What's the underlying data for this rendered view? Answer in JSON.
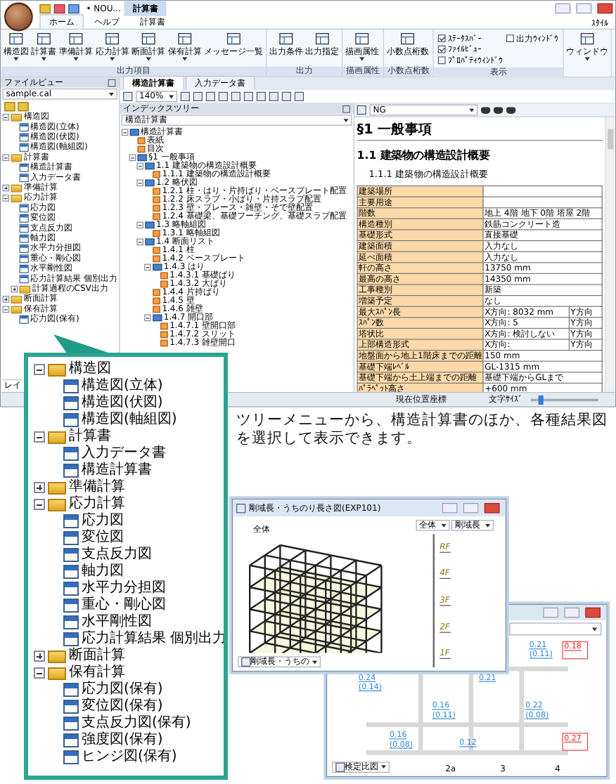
{
  "app": {
    "title": "• NOU...",
    "title_tab": "計算書",
    "style_menu": "ｽﾀｲﾙ",
    "ribbon_tabs": [
      {
        "label": "ホーム",
        "selected": true
      },
      {
        "label": "ヘルプ",
        "selected": false
      },
      {
        "label": "計算書",
        "selected": false
      }
    ],
    "groups": [
      {
        "kind": "buttons",
        "label": "出力項目",
        "buttons": [
          {
            "label": "構造図",
            "dropdown": true
          },
          {
            "label": "計算書",
            "dropdown": true
          },
          {
            "label": "準備計算",
            "dropdown": true
          },
          {
            "label": "応力計算",
            "dropdown": true
          },
          {
            "label": "断面計算",
            "dropdown": true
          },
          {
            "label": "保有計算",
            "dropdown": true
          },
          {
            "label": "メッセージ一覧",
            "dropdown": false
          }
        ]
      },
      {
        "kind": "buttons",
        "label": "出力",
        "buttons": [
          {
            "label": "出力条件",
            "dropdown": false
          },
          {
            "label": "出力指定",
            "dropdown": false
          }
        ]
      },
      {
        "kind": "buttons",
        "label": "描画属性",
        "buttons": [
          {
            "label": "描画属性",
            "dropdown": true
          }
        ]
      },
      {
        "kind": "buttons",
        "label": "小数点桁数",
        "buttons": [
          {
            "label": "小数点桁数",
            "dropdown": false
          }
        ]
      },
      {
        "kind": "checks",
        "label": "表示",
        "checks": [
          {
            "label": "ｽﾃｰﾀｽﾊﾞｰ",
            "checked": true
          },
          {
            "label": "ﾌｧｲﾙﾋﾞｭｰ",
            "checked": true
          },
          {
            "label": "ﾌﾟﾛﾊﾟﾃｨｳｨﾝﾄﾞｳ",
            "checked": false
          },
          {
            "label": "出力ｳｨﾝﾄﾞｳ",
            "checked": false
          }
        ]
      },
      {
        "kind": "buttons",
        "buttons": [
          {
            "label": "ウィンドウ",
            "dropdown": true
          }
        ]
      }
    ]
  },
  "file_view": {
    "title": "ファイルビュー",
    "file": "sample.cal",
    "bottom_tab": "レイ",
    "tree": [
      {
        "label": "構造図",
        "expanded": true,
        "children": [
          {
            "label": "構造図(立体)"
          },
          {
            "label": "構造図(伏図)"
          },
          {
            "label": "構造図(軸組図)"
          }
        ]
      },
      {
        "label": "計算書",
        "expanded": true,
        "children": [
          {
            "label": "構造計算書"
          },
          {
            "label": "入力データ書"
          }
        ]
      },
      {
        "label": "準備計算",
        "expanded": false
      },
      {
        "label": "応力計算",
        "expanded": true,
        "children": [
          {
            "label": "応力図"
          },
          {
            "label": "変位図"
          },
          {
            "label": "支点反力図"
          },
          {
            "label": "軸力図"
          },
          {
            "label": "水平力分担図"
          },
          {
            "label": "重心・剛心図"
          },
          {
            "label": "水平剛性図"
          },
          {
            "label": "応力計算結果 個別出力"
          },
          {
            "label": "計算過程のCSV出力",
            "expanded": false
          }
        ]
      },
      {
        "label": "断面計算",
        "expanded": false
      },
      {
        "label": "保有計算",
        "expanded": true,
        "children": [
          {
            "label": "応力図(保有)"
          }
        ]
      }
    ]
  },
  "doc_tabs": [
    {
      "label": "構造計算書",
      "selected": true
    },
    {
      "label": "入力データ書",
      "selected": false
    }
  ],
  "zoom": "140%",
  "index_tree": {
    "title": "インデックスツリー",
    "combo": "構造計算書",
    "tree": [
      {
        "label": "構造計算書",
        "expanded": true,
        "children": [
          {
            "label": "表紙"
          },
          {
            "label": "目次"
          },
          {
            "label": "§1 一般事項",
            "expanded": true,
            "children": [
              {
                "label": "1.1 建築物の構造設計概要",
                "expanded": true,
                "children": [
                  {
                    "label": "1.1.1 建築物の構造設計概要"
                  }
                ]
              },
              {
                "label": "1.2 略伏図",
                "expanded": true,
                "children": [
                  {
                    "label": "1.2.1 柱・はり・片持ばり・ベースプレート配置"
                  },
                  {
                    "label": "1.2.2 床スラブ・小ばり・片持スラブ配置"
                  },
                  {
                    "label": "1.2.3 壁・ブレース・雑壁・そで壁配置"
                  },
                  {
                    "label": "1.2.4 基礎梁、基礎フーチング、基礎スラブ配置"
                  }
                ]
              },
              {
                "label": "1.3 略軸組図",
                "expanded": true,
                "children": [
                  {
                    "label": "1.3.1 略軸組図"
                  }
                ]
              },
              {
                "label": "1.4 断面リスト",
                "expanded": true,
                "children": [
                  {
                    "label": "1.4.1 柱"
                  },
                  {
                    "label": "1.4.2 ベースプレート"
                  },
                  {
                    "label": "1.4.3 はり",
                    "expanded": true,
                    "children": [
                      {
                        "label": "1.4.3.1 基礎ばり"
                      },
                      {
                        "label": "1.4.3.2 大ばり"
                      }
                    ]
                  },
                  {
                    "label": "1.4.4 片持ばり"
                  },
                  {
                    "label": "1.4.5 壁"
                  },
                  {
                    "label": "1.4.6 雑壁"
                  },
                  {
                    "label": "1.4.7 開口部",
                    "expanded": true,
                    "children": [
                      {
                        "label": "1.4.7.1 壁開口部"
                      },
                      {
                        "label": "1.4.7.2 スリット"
                      },
                      {
                        "label": "1.4.7.3 雑壁開口"
                      }
                    ]
                  }
                ]
              }
            ]
          }
        ]
      }
    ]
  },
  "document": {
    "filter": "NG",
    "h1": "§1 一般事項",
    "h2": "1.1 建築物の構造設計概要",
    "h3": "1.1.1 建築物の構造設計概要",
    "rows": [
      {
        "label": "建築場所",
        "value": ""
      },
      {
        "label": "主要用途",
        "value": ""
      },
      {
        "label": "階数",
        "value": "地上 4階 地下 0階 塔屋 2階"
      },
      {
        "label": "構造種別",
        "value": "鉄筋コンクリート造"
      },
      {
        "label": "基礎形式",
        "value": "直接基礎"
      },
      {
        "label": "建築面積",
        "value": "入力なし"
      },
      {
        "label": "延べ面積",
        "value": "入力なし"
      },
      {
        "label": "軒の高さ",
        "value": "13750 mm"
      },
      {
        "label": "最高の高さ",
        "value": "14350 mm"
      },
      {
        "label": "工事種別",
        "value": "新築"
      },
      {
        "label": "増築予定",
        "value": "なし"
      },
      {
        "label": "最大ｽﾊﾟﾝ長",
        "value": "X方向: 8032 mm",
        "y": "Y方向"
      },
      {
        "label": "ｽﾊﾟﾝ数",
        "value": "X方向: 5",
        "y": "Y方向"
      },
      {
        "label": "塔状比",
        "value": "X方向: 検討しない",
        "y": "Y方向"
      },
      {
        "label": "上部構造形式",
        "value": "X方向:",
        "y": "Y方向"
      },
      {
        "label": "地盤面から地上1階床までの距離",
        "value": "150 mm"
      },
      {
        "label": "基礎下端ﾚﾍﾞﾙ",
        "value": "GL-1315 mm"
      },
      {
        "label": "基礎下端から土上端までの距離",
        "value": "基礎下端からGLまで"
      },
      {
        "label": "ﾊﾟﾗﾍﾟｯﾄ高さ",
        "value": "+600 mm"
      }
    ]
  },
  "status_bar": {
    "position": "現在位置座標",
    "font_size": "文字ｻｲｽﾞ",
    "font_slider": {
      "level": 0.15
    }
  },
  "callout": {
    "tree": [
      {
        "label": "構造図",
        "expanded": true,
        "children": [
          {
            "label": "構造図(立体)"
          },
          {
            "label": "構造図(伏図)"
          },
          {
            "label": "構造図(軸組図)"
          }
        ]
      },
      {
        "label": "計算書",
        "expanded": true,
        "children": [
          {
            "label": "入力データ書"
          },
          {
            "label": "構造計算書"
          }
        ]
      },
      {
        "label": "準備計算",
        "expanded": false
      },
      {
        "label": "応力計算",
        "expanded": true,
        "children": [
          {
            "label": "応力図"
          },
          {
            "label": "変位図"
          },
          {
            "label": "支点反力図"
          },
          {
            "label": "軸力図"
          },
          {
            "label": "水平力分担図"
          },
          {
            "label": "重心・剛心図"
          },
          {
            "label": "水平剛性図"
          },
          {
            "label": "応力計算結果 個別出力"
          }
        ]
      },
      {
        "label": "断面計算",
        "expanded": false
      },
      {
        "label": "保有計算",
        "expanded": true,
        "children": [
          {
            "label": "応力図(保有)"
          },
          {
            "label": "変位図(保有)"
          },
          {
            "label": "支点反力図(保有)"
          },
          {
            "label": "強度図(保有)"
          },
          {
            "label": "ヒンジ図(保有)"
          }
        ]
      }
    ]
  },
  "caption": "ツリーメニューから、構造計算書のほか、各種結果図を選択して表示できます。",
  "model_window": {
    "title": "剛域長・うちのり長さ図(EXP101)",
    "corner_label": "全体",
    "selects": [
      "全体",
      "剛域長"
    ],
    "floors": [
      "RF",
      "4F",
      "3F",
      "2F",
      "1F"
    ],
    "bottom_select": "剛域長・うちの"
  },
  "check_window": {
    "bottom_select": "検定比図",
    "axes": [
      "2a",
      "3",
      "4"
    ],
    "values": [
      {
        "text": "0.21",
        "alert": false
      },
      {
        "text": "(0.11)",
        "alert": false
      },
      {
        "text": "0.18",
        "alert": true
      },
      {
        "text": "0.24",
        "alert": false
      },
      {
        "text": "(0.14)",
        "alert": false
      },
      {
        "text": "0.21",
        "alert": false
      },
      {
        "text": "0.16",
        "alert": false
      },
      {
        "text": "(0.11)",
        "alert": false
      },
      {
        "text": "0.16",
        "alert": false
      },
      {
        "text": "(0.08)",
        "alert": false
      },
      {
        "text": "0.12",
        "alert": false
      },
      {
        "text": "0.22",
        "alert": false
      },
      {
        "text": "(0.08)",
        "alert": false
      },
      {
        "text": "0.27",
        "alert": true
      }
    ]
  }
}
